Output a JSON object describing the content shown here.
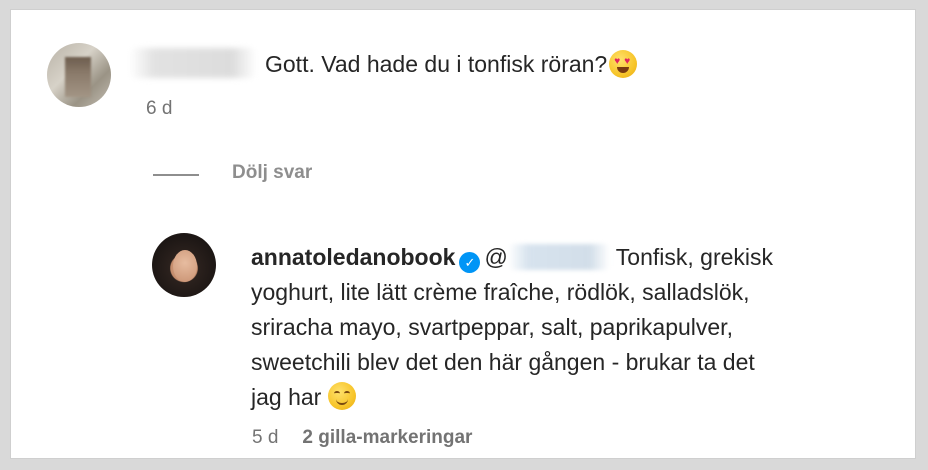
{
  "comment": {
    "text": "Gott. Vad hade du i tonfisk röran?",
    "emoji": "heart-eyes-emoji",
    "time": "6 d"
  },
  "replies_toggle": {
    "label": "Dölj svar"
  },
  "reply": {
    "username": "annatoledanobook",
    "mention_prefix": "@",
    "line1": " Tonfisk, grekisk",
    "line2": "yoghurt, lite lätt crème fraîche, rödlök, salladslök,",
    "line3": "sriracha mayo, svartpeppar, salt, paprikapulver,",
    "line4": "sweetchili blev det den här gången - brukar ta det",
    "line5": "jag har ",
    "emoji": "smiling-emoji",
    "time": "5 d",
    "likes": "2 gilla-markeringar"
  },
  "colors": {
    "verified": "#0095f6",
    "secondary_text": "#737373",
    "primary_text": "#262626"
  }
}
